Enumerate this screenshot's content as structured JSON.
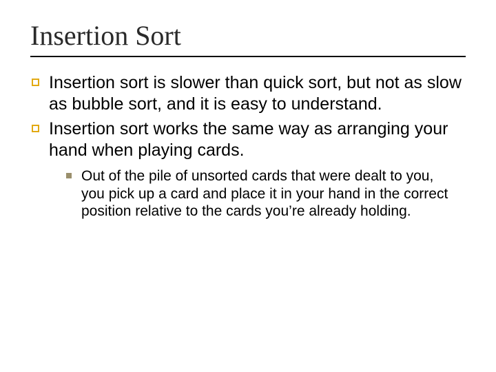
{
  "title": "Insertion Sort",
  "bullets": [
    {
      "text": "Insertion sort is slower than quick sort, but not as slow as bubble sort, and it is easy to understand."
    },
    {
      "text": "Insertion sort works the same way as arranging your hand when playing cards."
    }
  ],
  "subbullets": [
    {
      "text": "Out of the pile of unsorted cards that were dealt to you, you pick up a card and place it in your hand in the correct position relative to the cards you’re already holding."
    }
  ],
  "colors": {
    "outline_bullet": "#e2a912",
    "filled_bullet": "#9a8f6c"
  }
}
